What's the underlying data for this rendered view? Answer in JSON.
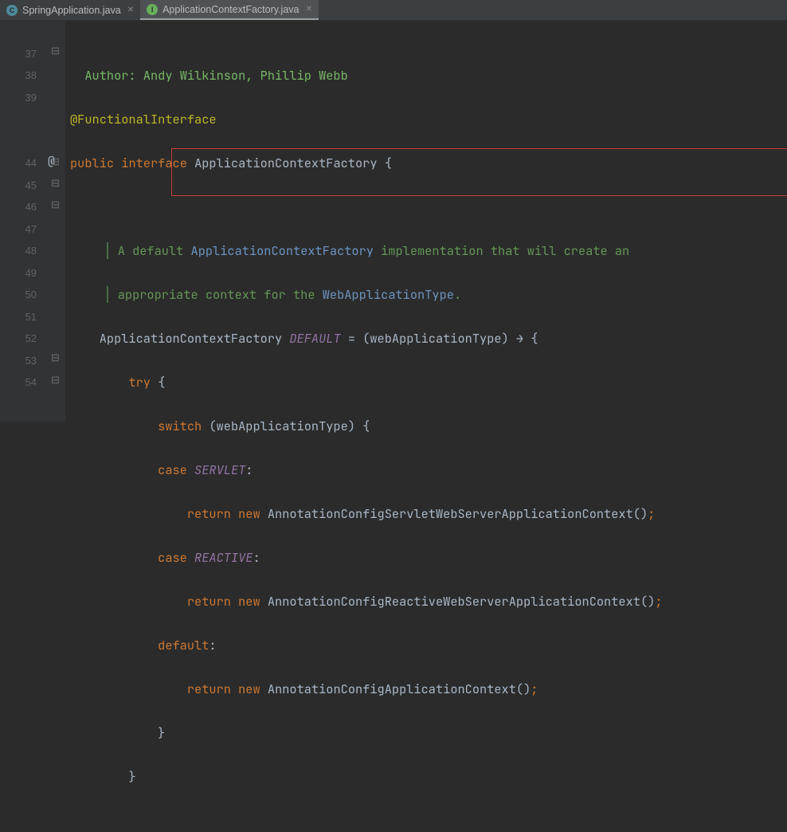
{
  "tabs": [
    {
      "label": "SpringApplication.java",
      "icon": "C",
      "active": false
    },
    {
      "label": "ApplicationContextFactory.java",
      "icon": "I",
      "active": true
    }
  ],
  "gutter": {
    "lines": [
      "",
      "37",
      "38",
      "39",
      "",
      "",
      "44",
      "45",
      "46",
      "47",
      "48",
      "49",
      "50",
      "51",
      "52",
      "53",
      "54"
    ],
    "override_at": "44"
  },
  "code": {
    "author_label": "Author:",
    "author_names": "Andy Wilkinson, Phillip Webb",
    "annotation": "@FunctionalInterface",
    "kw_public": "public",
    "kw_interface": "interface",
    "type_name": "ApplicationContextFactory",
    "brace_open": "{",
    "brace_close": "}",
    "doc_text1a": "A default ",
    "doc_link1": "ApplicationContextFactory",
    "doc_text1b": " implementation that will create an",
    "doc_text2a": "appropriate context for the ",
    "doc_link2": "WebApplicationType",
    "doc_text2b": ".",
    "default_type": "ApplicationContextFactory",
    "default_name": "DEFAULT",
    "eq": " = ",
    "lambda_param": "(webApplicationType)",
    "arrow": " → ",
    "brace": "{",
    "kw_try": "try",
    "kw_switch": "switch",
    "switch_expr": "(webApplicationType)",
    "kw_case": "case",
    "enum_servlet": "SERVLET",
    "enum_reactive": "REACTIVE",
    "kw_default": "default",
    "colon": ":",
    "kw_return": "return",
    "kw_new": "new",
    "ctor1": "AnnotationConfigServletWebServerApplicationContext()",
    "ctor2": "AnnotationConfigReactiveWebServerApplicationContext()",
    "ctor3": "AnnotationConfigApplicationContext()",
    "semi": ";"
  }
}
